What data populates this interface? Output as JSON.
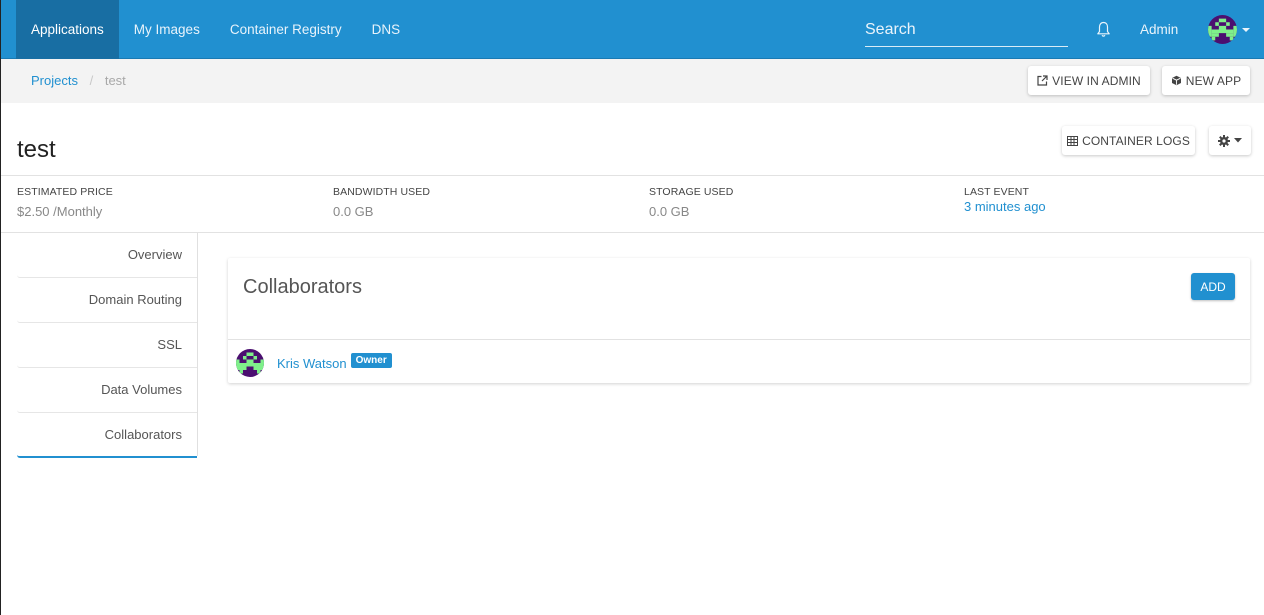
{
  "navbar": {
    "links": [
      {
        "label": "Applications",
        "active": true
      },
      {
        "label": "My Images",
        "active": false
      },
      {
        "label": "Container Registry",
        "active": false
      },
      {
        "label": "DNS",
        "active": false
      }
    ],
    "search_placeholder": "Search",
    "search_value": "",
    "admin_label": "Admin",
    "icons": {
      "notifications": "bell-icon",
      "user_menu": "caret-down-icon"
    },
    "brand_color": "#2190d0"
  },
  "breadcrumb": {
    "items": [
      {
        "label": "Projects",
        "link": true
      },
      {
        "label": "test",
        "link": false
      }
    ],
    "separator": "/"
  },
  "actions": {
    "view_in_admin": "VIEW IN ADMIN",
    "new_app": "NEW APP",
    "container_logs": "CONTAINER LOGS"
  },
  "page": {
    "title": "test"
  },
  "stats": [
    {
      "label": "ESTIMATED PRICE",
      "value": "$2.50 /Monthly"
    },
    {
      "label": "BANDWIDTH USED",
      "value": "0.0 GB"
    },
    {
      "label": "STORAGE USED",
      "value": "0.0 GB"
    },
    {
      "label": "LAST EVENT",
      "value": "3 minutes ago"
    }
  ],
  "sidenav": {
    "items": [
      {
        "label": "Overview",
        "active": false
      },
      {
        "label": "Domain Routing",
        "active": false
      },
      {
        "label": "SSL",
        "active": false
      },
      {
        "label": "Data Volumes",
        "active": false
      },
      {
        "label": "Collaborators",
        "active": true
      }
    ]
  },
  "collaborators": {
    "title": "Collaborators",
    "add_label": "ADD",
    "members": [
      {
        "name": "Kris Watson",
        "role": "Owner"
      }
    ]
  }
}
